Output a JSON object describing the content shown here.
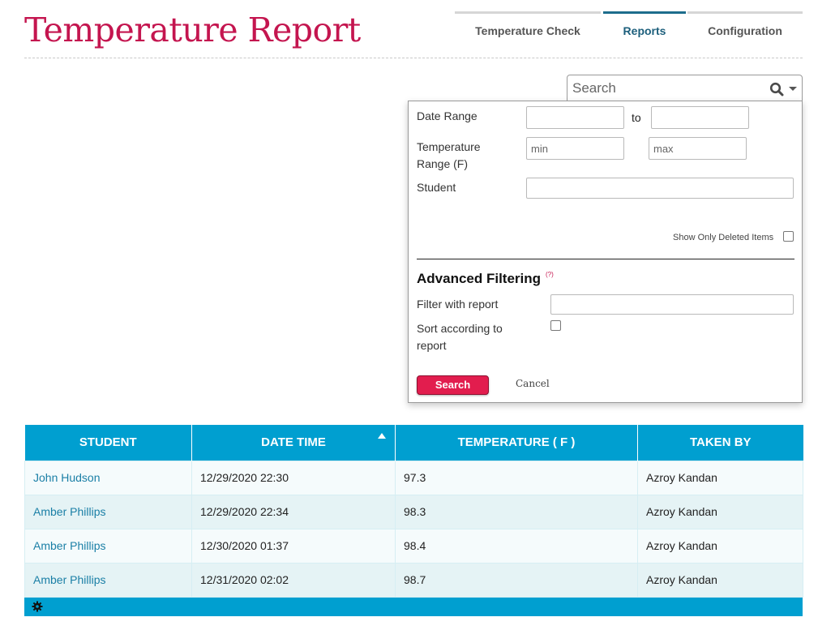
{
  "header": {
    "title": "Temperature Report",
    "tabs": [
      {
        "label": "Temperature Check",
        "active": false
      },
      {
        "label": "Reports",
        "active": true
      },
      {
        "label": "Configuration",
        "active": false
      }
    ]
  },
  "search": {
    "placeholder": "Search",
    "value": "",
    "icon": "search-icon",
    "dropdown_icon": "caret-down-icon"
  },
  "filters": {
    "date_range_label": "Date Range",
    "date_to_label": "to",
    "date_from_value": "",
    "date_to_value": "",
    "temperature_range_label": "Temperature Range (F)",
    "temp_min_placeholder": "min",
    "temp_max_placeholder": "max",
    "student_label": "Student",
    "student_value": "",
    "show_deleted_label": "Show Only Deleted Items",
    "show_deleted_checked": false,
    "advanced_heading": "Advanced Filtering",
    "help_mark": "(?)",
    "filter_with_report_label": "Filter with report",
    "filter_with_report_value": "",
    "sort_according_label": "Sort according to report",
    "sort_according_checked": false,
    "search_button": "Search",
    "cancel_link": "Cancel"
  },
  "table": {
    "columns": [
      "STUDENT",
      "DATE TIME",
      "TEMPERATURE ( F )",
      "TAKEN BY"
    ],
    "sorted_column": "DATE TIME",
    "sort_direction": "ascending",
    "rows": [
      {
        "student": "John Hudson",
        "datetime": "12/29/2020 22:30",
        "temperature": "97.3",
        "taken_by": "Azroy Kandan"
      },
      {
        "student": "Amber Phillips",
        "datetime": "12/29/2020 22:34",
        "temperature": "98.3",
        "taken_by": "Azroy Kandan"
      },
      {
        "student": "Amber Phillips",
        "datetime": "12/30/2020 01:37",
        "temperature": "98.4",
        "taken_by": "Azroy Kandan"
      },
      {
        "student": "Amber Phillips",
        "datetime": "12/31/2020 02:02",
        "temperature": "98.7",
        "taken_by": "Azroy Kandan"
      }
    ],
    "footer_icon": "gear-icon"
  },
  "colors": {
    "title": "#c4154f",
    "active_tab": "#1d6d8c",
    "table_header": "#009fd0",
    "student_link": "#1a7fa6",
    "search_button": "#e21d4e"
  }
}
